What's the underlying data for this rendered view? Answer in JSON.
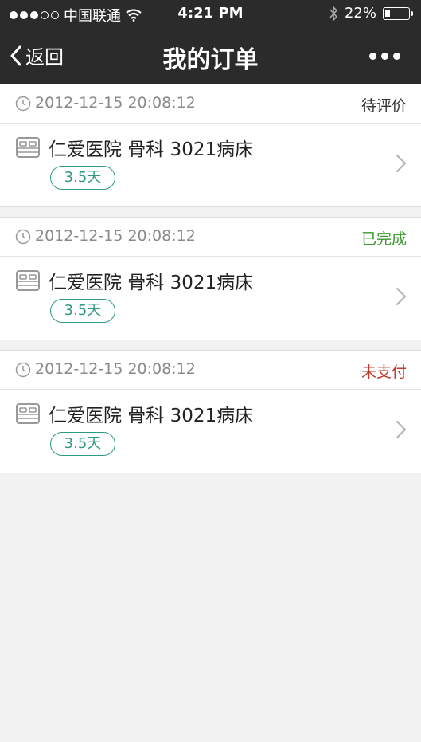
{
  "status_bar": {
    "carrier": "中国联通",
    "time": "4:21 PM",
    "battery": "22%",
    "battery_level": 0.22
  },
  "nav": {
    "back_label": "返回",
    "title": "我的订单"
  },
  "orders": [
    {
      "timestamp": "2012-12-15 20:08:12",
      "status": "待评价",
      "status_color": "#333333",
      "hospital": "仁爱医院 骨科 3021病床",
      "duration": "3.5天"
    },
    {
      "timestamp": "2012-12-15 20:08:12",
      "status": "已完成",
      "status_color": "#3a9a2e",
      "hospital": "仁爱医院 骨科 3021病床",
      "duration": "3.5天"
    },
    {
      "timestamp": "2012-12-15 20:08:12",
      "status": "未支付",
      "status_color": "#c0392b",
      "hospital": "仁爱医院 骨科 3021病床",
      "duration": "3.5天"
    }
  ],
  "colors": {
    "bar_bg": "#2b2b2b",
    "accent": "#2d9b84"
  }
}
